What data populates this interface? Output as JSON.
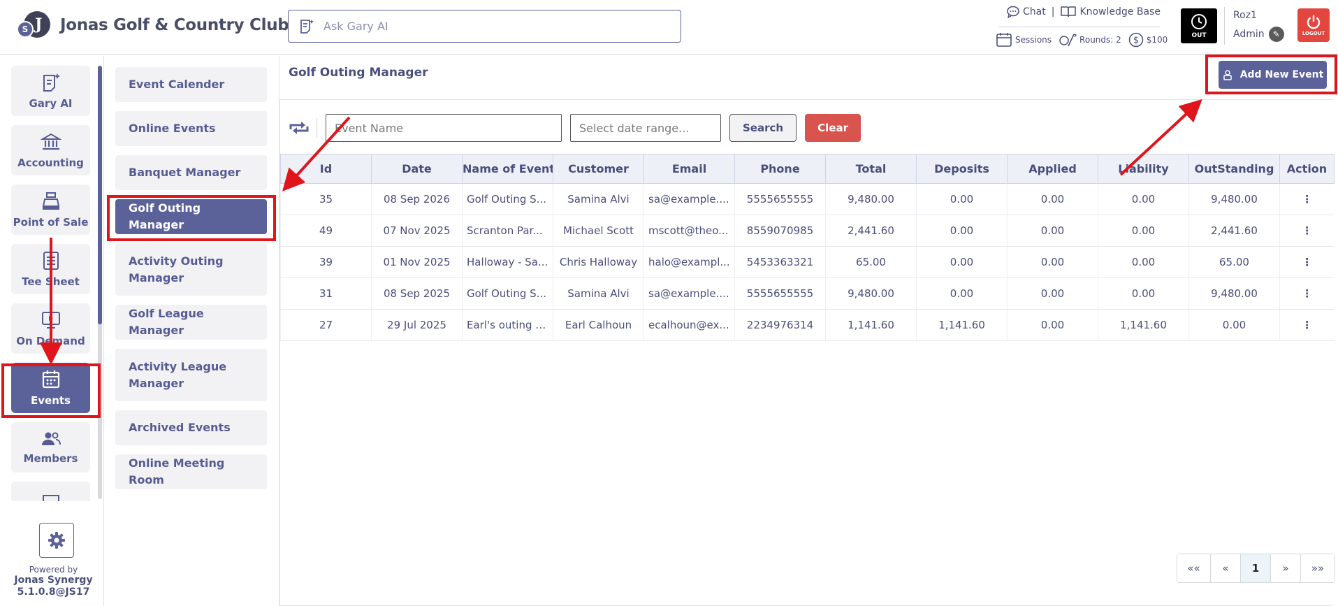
{
  "header": {
    "brand": "Jonas Golf & Country Club",
    "logo_letter": "J",
    "logo_small": "S",
    "ask_placeholder": "Ask Gary AI",
    "chat": "Chat",
    "separator": "|",
    "knowledge_base": "Knowledge Base",
    "sessions": "Sessions",
    "rounds": "Rounds: 2",
    "balance": "$100",
    "clock_label": "OUT",
    "user_name": "Roz1",
    "user_role": "Admin",
    "logout_label": "LOGOUT"
  },
  "rail": {
    "items": [
      {
        "label": "Gary AI",
        "icon": "gary-ai-icon"
      },
      {
        "label": "Accounting",
        "icon": "bank-icon"
      },
      {
        "label": "Point of Sale",
        "icon": "register-icon"
      },
      {
        "label": "Tee Sheet",
        "icon": "sheet-icon"
      },
      {
        "label": "On Demand",
        "icon": "monitor-icon"
      },
      {
        "label": "Events",
        "icon": "calendar-icon"
      },
      {
        "label": "Members",
        "icon": "members-icon"
      }
    ],
    "active": "Events",
    "powered_by": "Powered by",
    "product": "Jonas Synergy",
    "version": "5.1.0.8@JS17"
  },
  "submenu": {
    "items": [
      "Event Calender",
      "Online Events",
      "Banquet Manager",
      "Golf Outing Manager",
      "Activity Outing Manager",
      "Golf League Manager",
      "Activity League Manager",
      "Archived Events",
      "Online Meeting Room"
    ],
    "active": "Golf Outing Manager"
  },
  "main": {
    "title": "Golf Outing Manager",
    "add_button": "Add New Event",
    "event_name_placeholder": "Event Name",
    "date_placeholder": "Select date range...",
    "search_label": "Search",
    "clear_label": "Clear",
    "columns": [
      "Id",
      "Date",
      "Name of Event",
      "Customer",
      "Email",
      "Phone",
      "Total",
      "Deposits",
      "Applied",
      "Liability",
      "OutStanding",
      "Action"
    ],
    "rows": [
      [
        "35",
        "08 Sep 2026",
        "Golf Outing S...",
        "Samina Alvi",
        "sa@example....",
        "5555655555",
        "9,480.00",
        "0.00",
        "0.00",
        "0.00",
        "9,480.00"
      ],
      [
        "49",
        "07 Nov 2025",
        "Scranton Par...",
        "Michael Scott",
        "mscott@theo...",
        "8559070985",
        "2,441.60",
        "0.00",
        "0.00",
        "0.00",
        "2,441.60"
      ],
      [
        "39",
        "01 Nov 2025",
        "Halloway - Sa...",
        "Chris Halloway",
        "halo@exampl...",
        "5453363321",
        "65.00",
        "0.00",
        "0.00",
        "0.00",
        "65.00"
      ],
      [
        "31",
        "08 Sep 2025",
        "Golf Outing S...",
        "Samina Alvi",
        "sa@example....",
        "5555655555",
        "9,480.00",
        "0.00",
        "0.00",
        "0.00",
        "9,480.00"
      ],
      [
        "27",
        "29 Jul 2025",
        "Earl's outing e...",
        "Earl Calhoun",
        "ecalhoun@ex...",
        "2234976314",
        "1,141.60",
        "1,141.60",
        "0.00",
        "1,141.60",
        "0.00"
      ]
    ],
    "action_glyph": "⋮",
    "pager": [
      "««",
      "«",
      "1",
      "»",
      "»»"
    ],
    "current_page": "1"
  },
  "colors": {
    "accent": "#5b6199",
    "danger": "#d9534f",
    "annotation": "#e0141b"
  }
}
